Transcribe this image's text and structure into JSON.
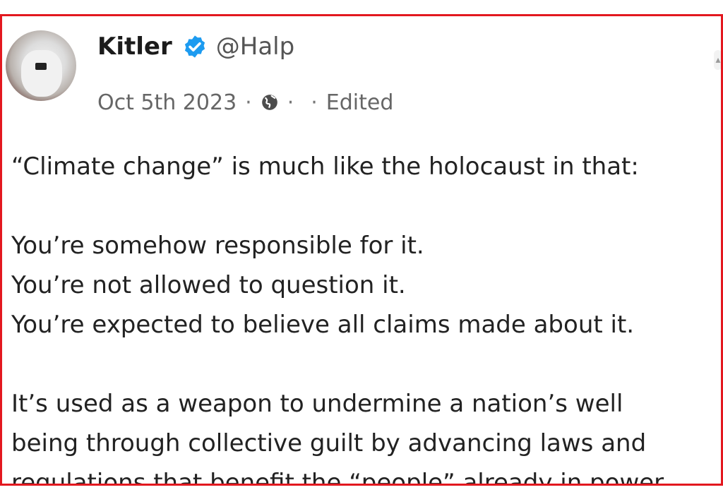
{
  "post": {
    "author_name": "Kitler",
    "handle": "@Halp",
    "date": "Oct 5th 2023",
    "edited_label": "Edited",
    "separator": "·",
    "verified_color": "#1d9bf0",
    "border_color": "#e3181f",
    "body": {
      "line_1": "“Climate change” is much like the holocaust in that:",
      "line_2": "You’re somehow responsible for it.",
      "line_3": "You’re not allowed to question it.",
      "line_4": "You’re expected to believe all claims made about it.",
      "line_5": "It’s used as a weapon to undermine a nation’s well",
      "line_6": "being through collective guilt by advancing laws and",
      "line_7": "regulations that benefit the “people” already in power"
    }
  },
  "icons": {
    "verified": "verified-badge-icon",
    "visibility": "globe-icon",
    "scroll": "chevron-up-icon"
  }
}
